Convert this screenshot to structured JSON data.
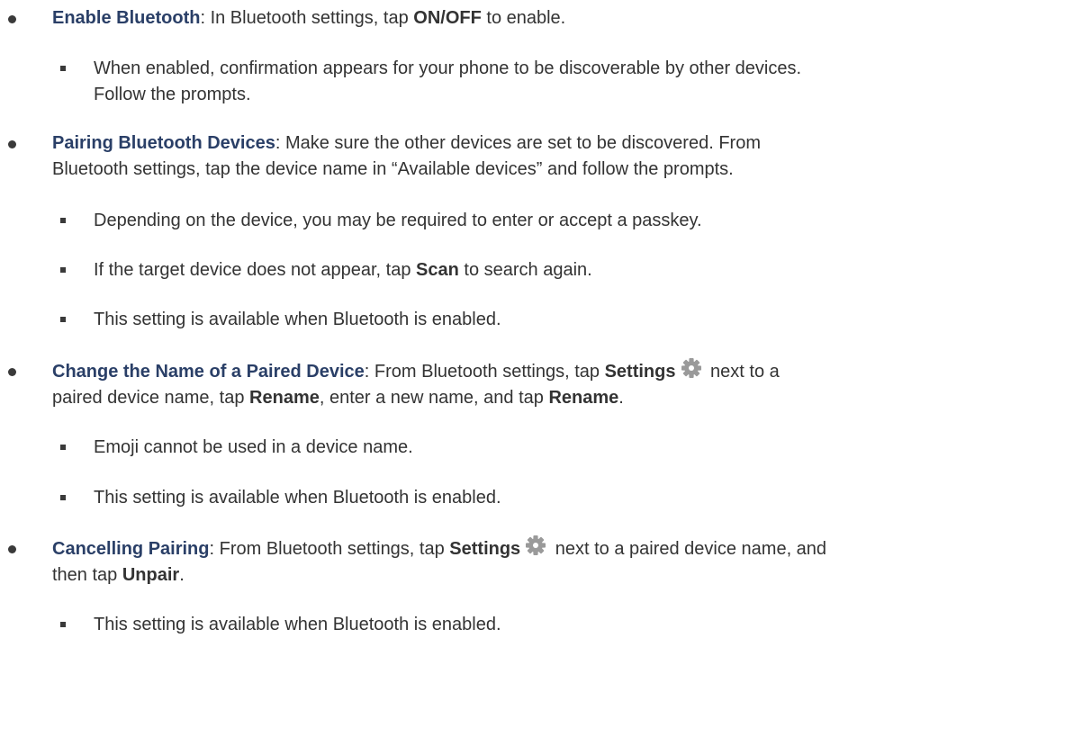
{
  "section1": {
    "title": "Enable Bluetooth",
    "text_a": ": In Bluetooth settings, tap ",
    "bold_a": "ON/OFF",
    "text_b": " to enable.",
    "sub1_line1": "When enabled, confirmation appears for your phone to be discoverable by other devices.",
    "sub1_line2": "Follow the prompts."
  },
  "section2": {
    "title": "Pairing Bluetooth Devices",
    "line1_rest": ": Make sure the other devices are set to be discovered. From",
    "line2": "Bluetooth settings, tap the device name in “Available devices” and follow the prompts.",
    "sub1": "Depending on the device, you may be required to enter or accept a passkey.",
    "sub2_a": "If the target device does not appear, tap ",
    "sub2_bold": "Scan",
    "sub2_b": " to search again.",
    "sub3": "This setting is available when Bluetooth is enabled."
  },
  "section3": {
    "title": "Change the Name of a Paired Device",
    "text_a": ": From Bluetooth settings, tap ",
    "bold_settings": "Settings",
    "text_b": " next to a",
    "text_c": "paired device name, tap ",
    "bold_rename1": "Rename",
    "text_d": ", enter a new name, and tap ",
    "bold_rename2": "Rename",
    "text_e": ".",
    "sub1": "Emoji cannot be used in a device name.",
    "sub2": "This setting is available when Bluetooth is enabled."
  },
  "section4": {
    "title": "Cancelling Pairing",
    "text_a": ": From Bluetooth settings, tap ",
    "bold_settings": "Settings",
    "text_b": " next to a paired device name, and",
    "text_c": "then tap ",
    "bold_unpair": "Unpair",
    "text_d": ".",
    "sub1": "This setting is available when Bluetooth is enabled."
  },
  "colors": {
    "title": "#2a3f67",
    "body_text": "#333333",
    "gear_icon": "#9a9a9a"
  },
  "icons": {
    "settings": "gear-icon"
  }
}
